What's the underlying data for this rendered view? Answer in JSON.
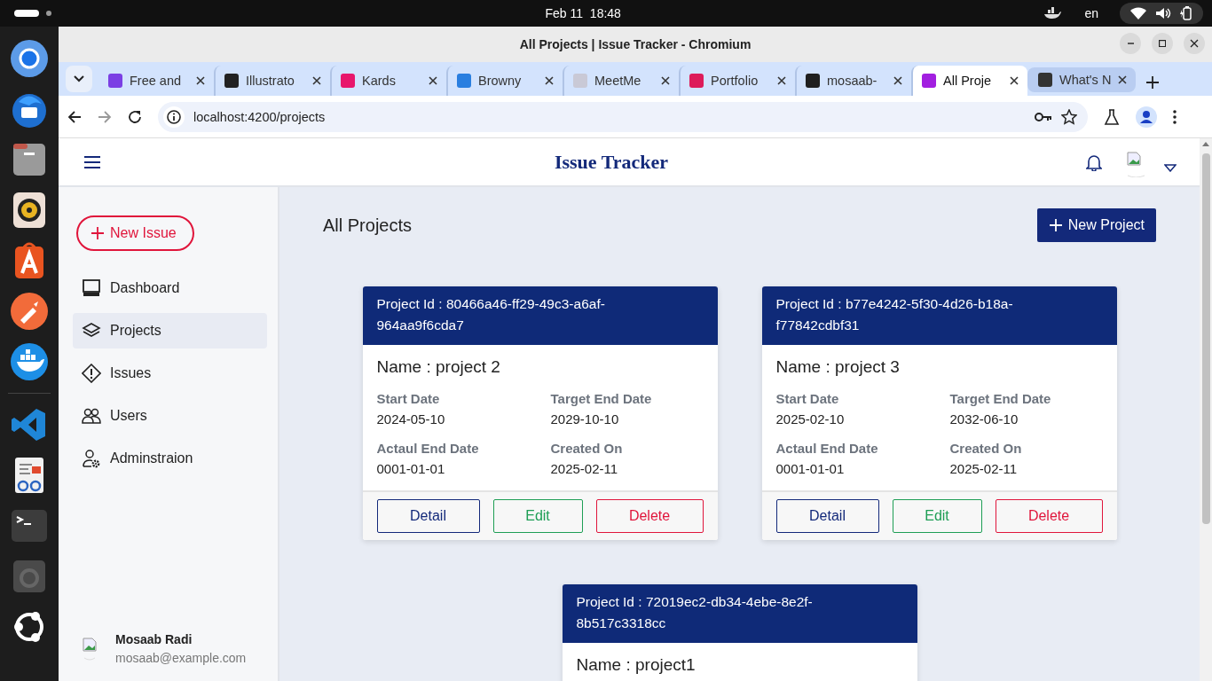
{
  "system_bar": {
    "datetime": "Feb 11  18:48",
    "language": "en"
  },
  "window": {
    "title": "All Projects | Issue Tracker - Chromium"
  },
  "tabs": [
    {
      "label": "Free and",
      "color": "#7b3fe4",
      "selected": false
    },
    {
      "label": "Illustrato",
      "color": "#222222",
      "selected": false
    },
    {
      "label": "Kards",
      "color": "#e8166c",
      "selected": false
    },
    {
      "label": "Browny",
      "color": "#2a7fe0",
      "selected": false
    },
    {
      "label": "MeetMe",
      "color": "#c9c9d6",
      "selected": false
    },
    {
      "label": "Portfolio",
      "color": "#dd1b5a",
      "selected": false
    },
    {
      "label": "mosaab-",
      "color": "#1f1f1f",
      "selected": false
    },
    {
      "label": "All Proje",
      "color": "#a21fe0",
      "selected": true
    },
    {
      "label": "What's N",
      "color": "#333333",
      "selected": false
    }
  ],
  "address_bar": {
    "url": "localhost:4200/projects"
  },
  "app": {
    "title": "Issue Tracker"
  },
  "sidebar": {
    "new_issue": "New Issue",
    "items": [
      {
        "label": "Dashboard",
        "kind": "monitor",
        "selected": false
      },
      {
        "label": "Projects",
        "kind": "layers",
        "selected": true
      },
      {
        "label": "Issues",
        "kind": "warning",
        "selected": false
      },
      {
        "label": "Users",
        "kind": "people",
        "selected": false
      },
      {
        "label": "Adminstraion",
        "kind": "admin",
        "selected": false
      }
    ],
    "user": {
      "name": "Mosaab Radi",
      "email": "mosaab@example.com"
    }
  },
  "page": {
    "heading": "All Projects",
    "new_project": "New Project"
  },
  "projects": [
    {
      "id_label": "Project Id : 80466a46-ff29-49c3-a6af-964aa9f6cda7",
      "name": "Name : project 2",
      "fields": [
        {
          "label": "Start Date",
          "value": "2024-05-10"
        },
        {
          "label": "Target End Date",
          "value": "2029-10-10"
        },
        {
          "label": "Actaul End Date",
          "value": "0001-01-01"
        },
        {
          "label": "Created On",
          "value": "2025-02-11"
        }
      ],
      "actions": [
        {
          "label": "Detail",
          "kind": "primary"
        },
        {
          "label": "Edit",
          "kind": "success"
        },
        {
          "label": "Delete",
          "kind": "danger"
        }
      ]
    },
    {
      "id_label": "Project Id : b77e4242-5f30-4d26-b18a-f77842cdbf31",
      "name": "Name : project 3",
      "fields": [
        {
          "label": "Start Date",
          "value": "2025-02-10"
        },
        {
          "label": "Target End Date",
          "value": "2032-06-10"
        },
        {
          "label": "Actaul End Date",
          "value": "0001-01-01"
        },
        {
          "label": "Created On",
          "value": "2025-02-11"
        }
      ],
      "actions": [
        {
          "label": "Detail",
          "kind": "primary"
        },
        {
          "label": "Edit",
          "kind": "success"
        },
        {
          "label": "Delete",
          "kind": "danger"
        }
      ]
    },
    {
      "id_label": "Project Id : 72019ec2-db34-4ebe-8e2f-8b517c3318cc",
      "name": "Name : project1"
    }
  ]
}
